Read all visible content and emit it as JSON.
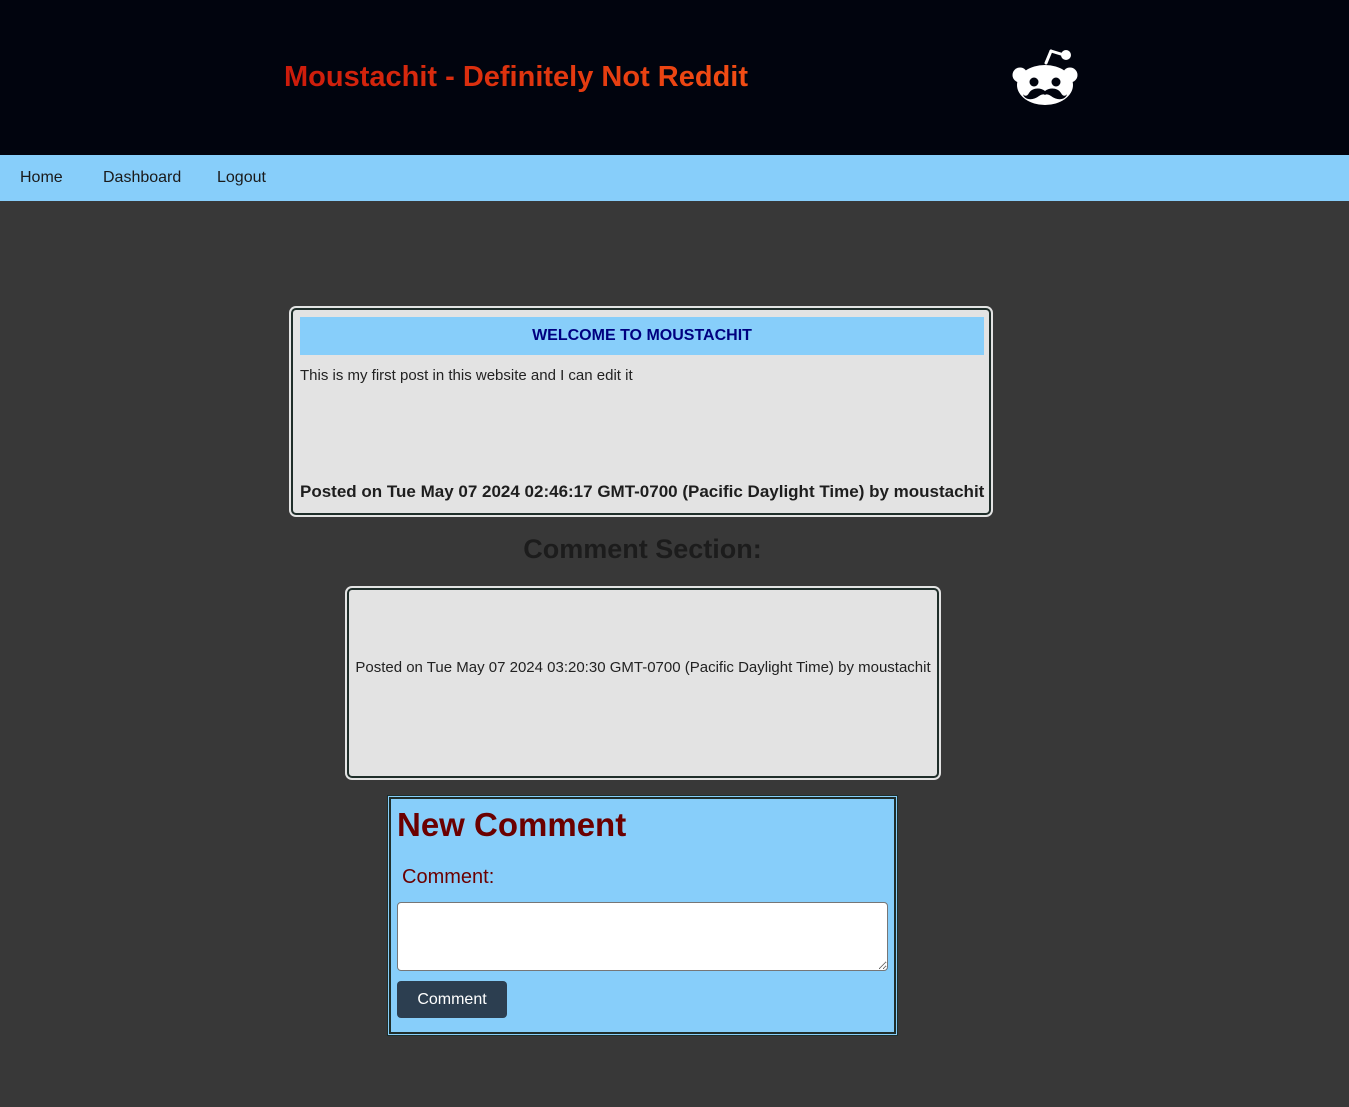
{
  "header": {
    "title": "Moustachit - Definitely Not Reddit",
    "logo_icon": "reddit-moustache-logo-icon"
  },
  "nav": {
    "home": "Home",
    "dashboard": "Dashboard",
    "logout": "Logout"
  },
  "post": {
    "title": "WELCOME TO MOUSTACHIT",
    "body": "This is my first post in this website and I can edit it",
    "meta": "Posted on Tue May 07 2024 02:46:17 GMT-0700 (Pacific Daylight Time) by moustachit"
  },
  "comments": {
    "heading": "Comment Section:",
    "items": [
      {
        "text": "",
        "meta": "Posted on Tue May 07 2024 03:20:30 GMT-0700 (Pacific Daylight Time) by moustachit"
      }
    ]
  },
  "new_comment": {
    "title": "New Comment",
    "label": "Comment:",
    "value": "",
    "button": "Comment"
  },
  "colors": {
    "header_bg": "#01040e",
    "nav_bg": "#87cefa",
    "page_bg": "#383838",
    "title_accent": "#cc1b0b",
    "post_title_text": "#000080",
    "new_comment_text": "#6b0000",
    "button_bg": "#2c3e50"
  }
}
